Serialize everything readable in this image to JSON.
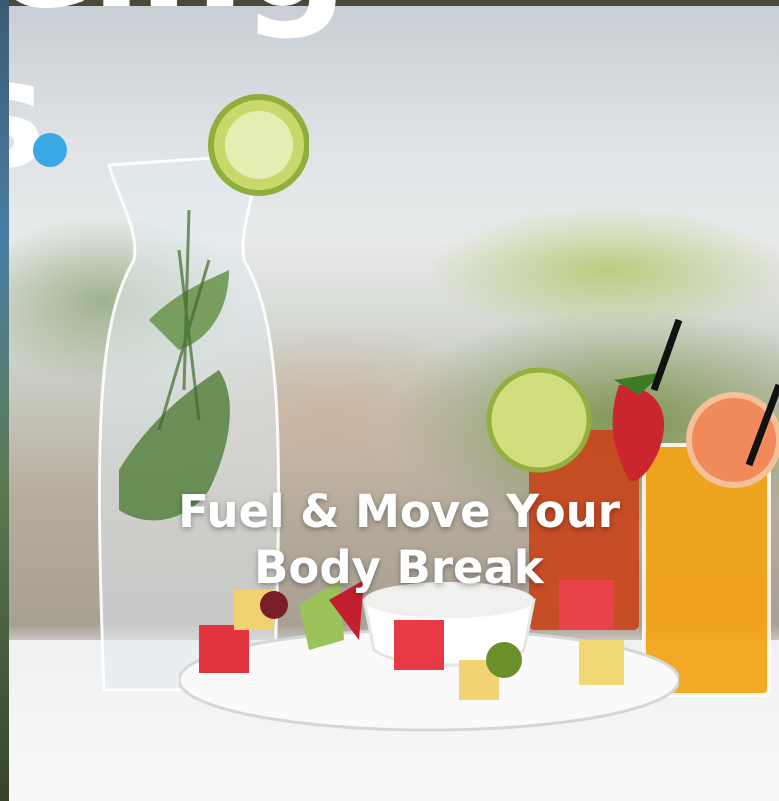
{
  "page": {
    "heading_fragment_top": "eing",
    "heading_fragment_second": "s",
    "accent_color": "#3aa8e4"
  },
  "card": {
    "title": "Fuel & Move Your Body Break",
    "image_alt": "Infused water carafe, fruit skewers with dip and fresh juices on a table"
  }
}
